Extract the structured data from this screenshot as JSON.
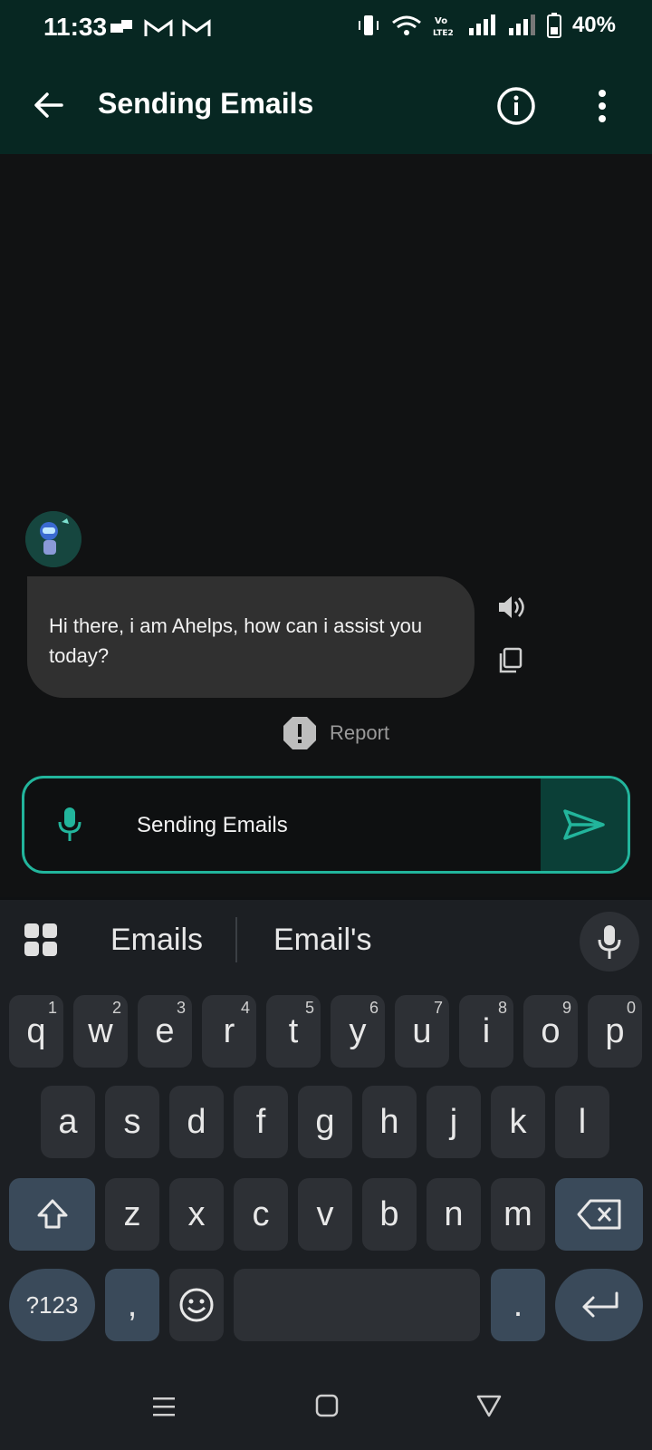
{
  "status": {
    "time": "11:33",
    "battery": "40%"
  },
  "appbar": {
    "title": "Sending Emails"
  },
  "chat": {
    "message": "Hi there, i am Ahelps, how can i assist you today?",
    "report_label": "Report"
  },
  "input": {
    "value": "Sending Emails"
  },
  "keyboard": {
    "suggestions": [
      "Emails",
      "Email's"
    ],
    "row1": [
      {
        "k": "q",
        "n": "1"
      },
      {
        "k": "w",
        "n": "2"
      },
      {
        "k": "e",
        "n": "3"
      },
      {
        "k": "r",
        "n": "4"
      },
      {
        "k": "t",
        "n": "5"
      },
      {
        "k": "y",
        "n": "6"
      },
      {
        "k": "u",
        "n": "7"
      },
      {
        "k": "i",
        "n": "8"
      },
      {
        "k": "o",
        "n": "9"
      },
      {
        "k": "p",
        "n": "0"
      }
    ],
    "row2": [
      "a",
      "s",
      "d",
      "f",
      "g",
      "h",
      "j",
      "k",
      "l"
    ],
    "row3": [
      "z",
      "x",
      "c",
      "v",
      "b",
      "n",
      "m"
    ],
    "symbols_label": "?123",
    "comma": ",",
    "period": "."
  },
  "colors": {
    "accent": "#22b59c",
    "appbar": "#072722",
    "bubble": "#303030"
  },
  "icons": [
    "back-arrow-icon",
    "info-icon",
    "more-vert-icon",
    "mic-icon",
    "send-icon",
    "speaker-icon",
    "copy-icon",
    "report-icon",
    "grid-icon",
    "shift-icon",
    "backspace-icon",
    "emoji-icon",
    "enter-icon",
    "menu-icon",
    "home-icon",
    "back-icon"
  ]
}
